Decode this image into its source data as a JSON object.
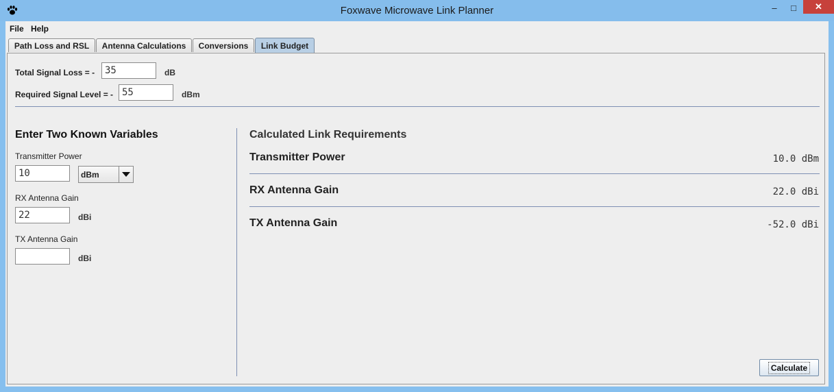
{
  "window": {
    "title": "Foxwave Microwave Link Planner",
    "minimize": "–",
    "maximize": "□",
    "close": "✕",
    "icon": "paw-icon"
  },
  "menu": {
    "items": [
      "File",
      "Help"
    ]
  },
  "tabs": [
    {
      "label": "Path Loss and RSL",
      "active": false
    },
    {
      "label": "Antenna Calculations",
      "active": false
    },
    {
      "label": "Conversions",
      "active": false
    },
    {
      "label": "Link Budget",
      "active": true
    }
  ],
  "top": {
    "signal_loss_label": "Total Signal Loss = -",
    "signal_loss_value": "35",
    "signal_loss_unit": "dB",
    "signal_level_label": "Required Signal Level = -",
    "signal_level_value": "55",
    "signal_level_unit": "dBm"
  },
  "inputs": {
    "heading": "Enter Two Known Variables",
    "tx_power_label": "Transmitter Power",
    "tx_power_value": "10",
    "tx_power_unit": "dBm",
    "rx_gain_label": "RX Antenna Gain",
    "rx_gain_value": "22",
    "rx_gain_unit": "dBi",
    "tx_gain_label": "TX Antenna Gain",
    "tx_gain_value": "",
    "tx_gain_unit": "dBi"
  },
  "results": {
    "heading": "Calculated Link Requirements",
    "rows": [
      {
        "label": "Transmitter Power",
        "value": "10.0 dBm"
      },
      {
        "label": "RX Antenna Gain",
        "value": "22.0 dBi"
      },
      {
        "label": "TX Antenna Gain",
        "value": "-52.0 dBi"
      }
    ]
  },
  "calculate_label": "Calculate",
  "colors": {
    "titlebar": "#85bdec",
    "active_tab": "#b8cfe5",
    "divider": "#7d8fb3",
    "close": "#c7413b"
  }
}
